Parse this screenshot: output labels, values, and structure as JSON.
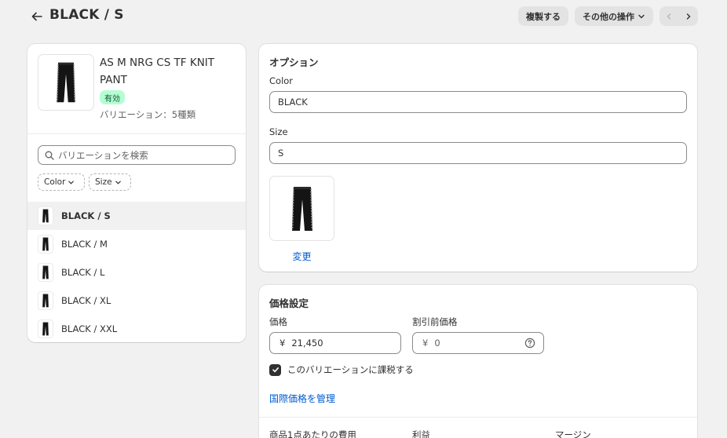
{
  "header": {
    "title": "BLACK / S",
    "duplicate_label": "複製する",
    "more_actions_label": "その他の操作"
  },
  "product": {
    "name": "AS M NRG CS TF KNIT PANT",
    "status": "有効",
    "variant_count": "バリエーション：5種類"
  },
  "search": {
    "placeholder": "バリエーションを検索"
  },
  "filters": {
    "color_label": "Color",
    "size_label": "Size"
  },
  "variants": [
    {
      "label": "BLACK / S",
      "selected": true
    },
    {
      "label": "BLACK / M",
      "selected": false
    },
    {
      "label": "BLACK / L",
      "selected": false
    },
    {
      "label": "BLACK / XL",
      "selected": false
    },
    {
      "label": "BLACK / XXL",
      "selected": false
    }
  ],
  "options": {
    "title": "オプション",
    "color_label": "Color",
    "color_value": "BLACK",
    "size_label": "Size",
    "size_value": "S",
    "change_label": "変更"
  },
  "pricing": {
    "title": "価格設定",
    "price_label": "価格",
    "currency": "¥",
    "price_value": "21,450",
    "compare_label": "割引前価格",
    "compare_value": "0",
    "tax_label": "このバリエーションに課税する",
    "tax_checked": true,
    "intl_link": "国際価格を管理",
    "cost_label": "商品1点あたりの費用",
    "profit_label": "利益",
    "margin_label": "マージン"
  },
  "colors": {
    "badge_bg": "#b4fed2",
    "badge_text": "#0c5132",
    "link": "#005bd3",
    "page_bg": "#f1f1f1"
  },
  "icons": {
    "back": "arrow-left-icon",
    "more_chevron": "chevron-down-icon",
    "prev": "chevron-left-icon",
    "next": "chevron-right-icon",
    "search": "search-icon",
    "help": "question-circle-icon",
    "checkbox": "checkmark-icon",
    "product_image": "pants-image"
  }
}
